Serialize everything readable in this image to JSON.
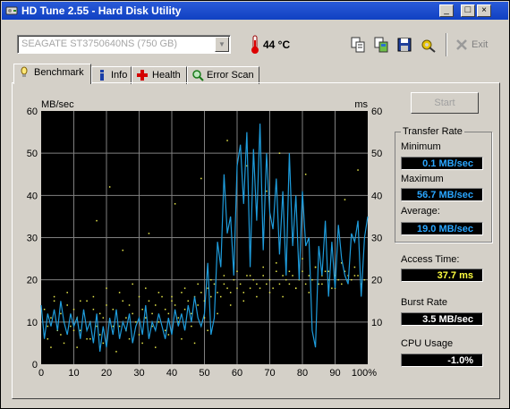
{
  "window": {
    "title": "HD Tune 2.55 - Hard Disk Utility",
    "minimize_glyph": "_",
    "restore_glyph": "□",
    "close_glyph": "×"
  },
  "toolbar": {
    "drive": "SEAGATE ST3750640NS (750 GB)",
    "temperature": "44 °C",
    "exit_label": "Exit",
    "icons": [
      "copy-text-icon",
      "copy-screenshot-icon",
      "save-icon",
      "options-icon",
      "exit-icon"
    ]
  },
  "tabs": [
    {
      "label": "Benchmark",
      "icon": "benchmark-icon",
      "active": true
    },
    {
      "label": "Info",
      "icon": "info-icon",
      "active": false
    },
    {
      "label": "Health",
      "icon": "health-icon",
      "active": false
    },
    {
      "label": "Error Scan",
      "icon": "error-scan-icon",
      "active": false
    }
  ],
  "benchmark": {
    "start_label": "Start",
    "transfer_rate_title": "Transfer Rate",
    "minimum_label": "Minimum",
    "minimum_value": "0.1 MB/sec",
    "maximum_label": "Maximum",
    "maximum_value": "56.7 MB/sec",
    "average_label": "Average:",
    "average_value": "19.0 MB/sec",
    "access_time_label": "Access Time:",
    "access_time_value": "37.7 ms",
    "burst_rate_label": "Burst Rate",
    "burst_rate_value": "3.5 MB/sec",
    "cpu_usage_label": "CPU Usage",
    "cpu_usage_value": "-1.0%"
  },
  "colors": {
    "title_bar": "#1845c8",
    "plot_background": "#000000",
    "grid": "#808080",
    "transfer_line": "#1e9cdc",
    "access_points": "#e8e84a",
    "value_blue": "#2aa6ff",
    "value_yellow": "#ffff40",
    "value_white": "#ffffff"
  },
  "chart_data": {
    "type": "line",
    "left_axis_unit": "MB/sec",
    "right_axis_unit": "ms",
    "ylim": [
      0,
      60
    ],
    "xlim": [
      0,
      100
    ],
    "y_ticks": [
      0,
      10,
      20,
      30,
      40,
      50,
      60
    ],
    "x_ticks": [
      "0",
      "10",
      "20",
      "30",
      "40",
      "50",
      "60",
      "70",
      "80",
      "90",
      "100%"
    ],
    "right_y_ticks": [
      10,
      20,
      30,
      40,
      50,
      60
    ],
    "grid": true,
    "series": [
      {
        "kind": "transfer_rate",
        "x": [
          0,
          1,
          2,
          3,
          4,
          5,
          6,
          7,
          8,
          9,
          10,
          11,
          12,
          13,
          14,
          15,
          16,
          17,
          18,
          19,
          20,
          21,
          22,
          23,
          24,
          25,
          26,
          27,
          28,
          29,
          30,
          31,
          32,
          33,
          34,
          35,
          36,
          37,
          38,
          39,
          40,
          41,
          42,
          43,
          44,
          45,
          46,
          47,
          48,
          49,
          50,
          51,
          52,
          53,
          54,
          55,
          56,
          57,
          58,
          59,
          60,
          61,
          62,
          63,
          64,
          65,
          66,
          67,
          68,
          69,
          70,
          71,
          72,
          73,
          74,
          75,
          76,
          77,
          78,
          79,
          80,
          81,
          82,
          83,
          84,
          85,
          86,
          87,
          88,
          89,
          90,
          91,
          92,
          93,
          94,
          95,
          96,
          97,
          98,
          99,
          100
        ],
        "y": [
          14,
          6,
          12,
          9,
          13,
          8,
          15,
          10,
          7,
          12,
          9,
          11,
          6,
          13,
          8,
          10,
          5,
          12,
          3,
          9,
          4,
          11,
          7,
          13,
          6,
          10,
          8,
          12,
          5,
          9,
          11,
          7,
          14,
          6,
          10,
          8,
          12,
          9,
          6,
          11,
          7,
          13,
          9,
          12,
          8,
          14,
          10,
          16,
          11,
          9,
          12,
          24,
          7,
          11,
          29,
          23,
          45,
          31,
          35,
          21,
          47,
          52,
          38,
          55,
          23,
          51,
          34,
          57,
          27,
          50,
          36,
          32,
          44,
          26,
          41,
          21,
          50,
          28,
          40,
          20,
          41,
          28,
          30,
          8,
          4,
          28,
          21,
          34,
          16,
          29,
          18,
          33,
          25,
          21,
          19,
          31,
          29,
          34,
          16,
          30,
          35
        ]
      },
      {
        "kind": "access_time",
        "x": [
          1,
          2,
          3,
          4,
          5,
          6,
          7,
          8,
          9,
          10,
          11,
          12,
          13,
          14,
          15,
          16,
          17,
          18,
          19,
          20,
          21,
          22,
          23,
          24,
          25,
          26,
          27,
          28,
          29,
          30,
          31,
          32,
          33,
          34,
          35,
          36,
          37,
          38,
          39,
          40,
          41,
          42,
          43,
          44,
          45,
          46,
          47,
          48,
          49,
          50,
          51,
          52,
          53,
          54,
          55,
          56,
          57,
          58,
          59,
          60,
          61,
          62,
          63,
          64,
          65,
          66,
          67,
          68,
          69,
          70,
          71,
          72,
          73,
          74,
          75,
          76,
          77,
          78,
          79,
          80,
          81,
          82,
          83,
          84,
          85,
          86,
          87,
          88,
          89,
          90,
          91,
          92,
          93,
          94,
          95,
          96,
          97,
          98,
          99,
          2,
          6,
          10,
          14,
          18,
          22,
          26,
          30,
          34,
          38,
          42,
          46,
          50,
          54,
          58,
          62,
          66,
          70,
          74,
          78,
          82,
          86,
          90,
          94,
          98,
          4,
          8,
          12,
          16,
          20,
          24,
          28,
          32,
          36,
          40,
          44,
          48,
          52,
          56,
          60,
          64,
          68,
          72,
          76,
          80,
          84,
          88,
          92,
          96,
          3,
          7,
          11,
          15,
          19,
          23,
          27,
          31,
          35,
          39,
          43,
          47,
          51,
          17,
          21,
          25,
          33,
          41,
          49,
          57,
          63,
          69,
          73,
          81,
          93,
          97
        ],
        "y": [
          13,
          9,
          11,
          15,
          8,
          12,
          10,
          14,
          9,
          13,
          11,
          8,
          12,
          15,
          10,
          13,
          9,
          12,
          11,
          14,
          10,
          13,
          12,
          9,
          15,
          11,
          14,
          12,
          10,
          16,
          13,
          11,
          15,
          12,
          14,
          10,
          16,
          13,
          12,
          15,
          14,
          11,
          17,
          13,
          15,
          12,
          16,
          14,
          17,
          15,
          18,
          16,
          19,
          17,
          16,
          19,
          18,
          17,
          20,
          18,
          19,
          17,
          21,
          18,
          20,
          19,
          18,
          21,
          19,
          20,
          18,
          22,
          19,
          21,
          20,
          19,
          21,
          18,
          20,
          22,
          19,
          21,
          20,
          23,
          19,
          21,
          22,
          20,
          18,
          21,
          20,
          19,
          22,
          21,
          20,
          23,
          21,
          19,
          20,
          6,
          7,
          8,
          6,
          7,
          9,
          8,
          7,
          9,
          8,
          10,
          9,
          11,
          12,
          14,
          15,
          16,
          17,
          16,
          18,
          17,
          19,
          18,
          20,
          19,
          16,
          17,
          15,
          16,
          18,
          17,
          19,
          18,
          17,
          16,
          18,
          19,
          20,
          21,
          22,
          21,
          23,
          24,
          22,
          25,
          23,
          22,
          24,
          21,
          4,
          5,
          4,
          6,
          5,
          3,
          6,
          5,
          4,
          7,
          6,
          5,
          8,
          34,
          42,
          27,
          31,
          38,
          44,
          53,
          47,
          41,
          50,
          45,
          39,
          46
        ]
      }
    ]
  }
}
